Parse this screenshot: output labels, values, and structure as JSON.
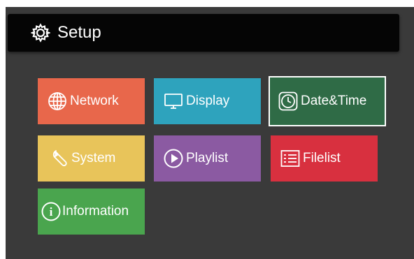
{
  "header": {
    "title": "Setup",
    "icon": "gear-icon"
  },
  "tiles": [
    {
      "label": "Network",
      "icon": "globe-icon",
      "color": "#e8674b",
      "selected": false
    },
    {
      "label": "Display",
      "icon": "monitor-icon",
      "color": "#2ea3bd",
      "selected": false
    },
    {
      "label": "Date&Time",
      "icon": "clock-icon",
      "color": "#2f6b46",
      "selected": true
    },
    {
      "label": "System",
      "icon": "wrench-icon",
      "color": "#e8c45a",
      "selected": false
    },
    {
      "label": "Playlist",
      "icon": "play-icon",
      "color": "#8b5aa2",
      "selected": false
    },
    {
      "label": "Filelist",
      "icon": "list-icon",
      "color": "#d8303f",
      "selected": false
    },
    {
      "label": "Information",
      "icon": "info-icon",
      "color": "#4aa54e",
      "selected": false
    }
  ]
}
